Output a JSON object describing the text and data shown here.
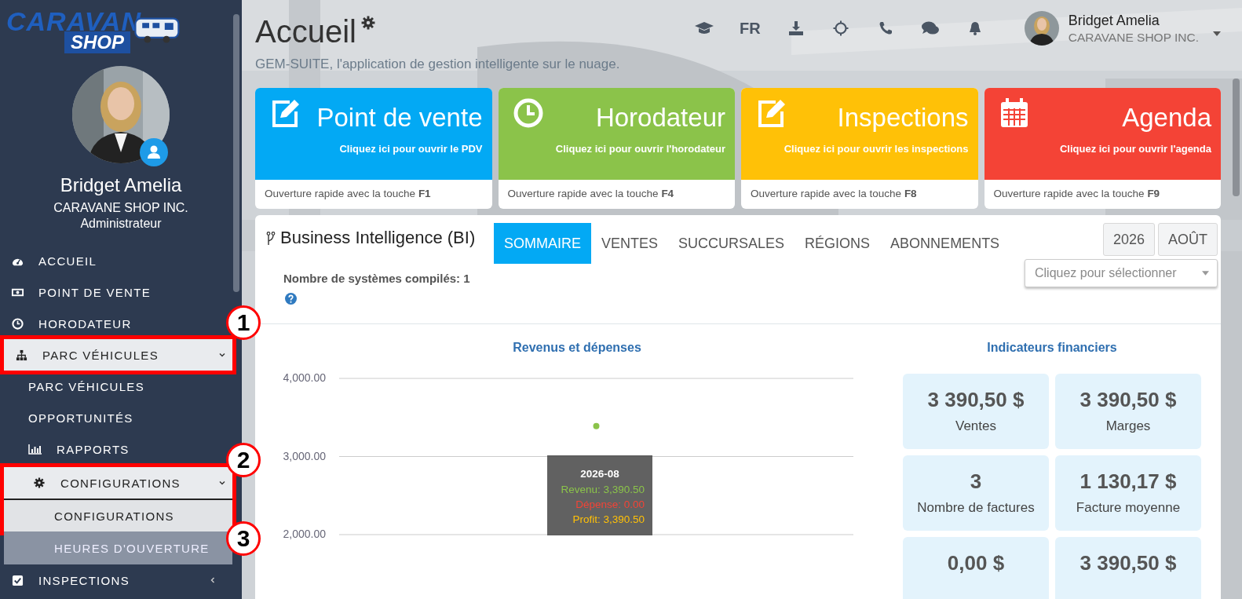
{
  "sidebar": {
    "logo": {
      "line_1": "CARAVAN",
      "line_2": "SHOP"
    },
    "user": {
      "name": "Bridget Amelia",
      "company": "CARAVANE SHOP INC.",
      "role": "Administrateur"
    },
    "menu": [
      {
        "label": "ACCUEIL",
        "selected": false
      },
      {
        "label": "POINT DE VENTE",
        "selected": false
      },
      {
        "label": "HORODATEUR",
        "selected": false
      },
      {
        "label": "PARC VÉHICULES",
        "selected": false,
        "expanded": true,
        "children": [
          {
            "label": "PARC VÉHICULES",
            "selected": false
          },
          {
            "label": "OPPORTUNITÉS",
            "selected": false
          },
          {
            "label": "RAPPORTS",
            "selected": false
          },
          {
            "label": "CONFIGURATIONS",
            "selected": false,
            "expanded": true,
            "children": [
              {
                "label": "CONFIGURATIONS",
                "selected": true,
                "hovered": false
              },
              {
                "label": "HEURES D'OUVERTURE",
                "selected": false,
                "hovered": true
              }
            ]
          }
        ]
      },
      {
        "label": "INSPECTIONS",
        "selected": false,
        "expanded": false
      }
    ]
  },
  "header": {
    "title": "Accueil",
    "subtitle": "GEM-SUITE, l'application de gestion intelligente sur le nuage.",
    "language": "FR",
    "user": {
      "name": "Bridget Amelia",
      "company": "CARAVANE SHOP INC."
    }
  },
  "tiles": [
    {
      "title": "Point de vente",
      "link": "Cliquez ici pour ouvrir le PDV",
      "footer": "Ouverture rapide avec la touche **F1**",
      "color": "#03a9f4"
    },
    {
      "title": "Horodateur",
      "link": "Cliquez ici pour ouvrir l'horodateur",
      "footer": "Ouverture rapide avec la touche **F4**",
      "color": "#8bc34a"
    },
    {
      "title": "Inspections",
      "link": "Cliquez ici pour ouvrir les inspections",
      "footer": "Ouverture rapide avec la touche **F8**",
      "color": "#ffc107"
    },
    {
      "title": "Agenda",
      "link": "Cliquez ici pour ouvrir l'agenda",
      "footer": "Ouverture rapide avec la touche **F9**",
      "color": "#f44336"
    }
  ],
  "bi": {
    "title": "Business Intelligence (BI)",
    "systems": "Nombre de systèmes compilés: 1",
    "tabs": [
      {
        "label": "SOMMAIRE",
        "selected": true
      },
      {
        "label": "VENTES",
        "selected": false
      },
      {
        "label": "SUCCURSALES",
        "selected": false
      },
      {
        "label": "RÉGIONS",
        "selected": false
      },
      {
        "label": "ABONNEMENTS",
        "selected": false
      }
    ],
    "year": "2026",
    "month": "AOÛT",
    "select": {
      "placeholder": "Cliquez pour sélectionner"
    },
    "chart": {
      "chart_data": {
        "type": "line",
        "title": "Revenus et dépenses",
        "categories": [
          "2026-08"
        ],
        "ylim": [
          2000,
          4000
        ],
        "yticks": [
          {
            "value": 2000,
            "label": "2,000.00"
          },
          {
            "value": 3000,
            "label": "3,000.00"
          },
          {
            "value": 4000,
            "label": "4,000.00"
          }
        ],
        "series": [
          {
            "color": "#8bc34a",
            "marker": true,
            "values": [
              3390
            ]
          }
        ]
      },
      "tooltip": {
        "lines": [
          {
            "text": "Revenu: 3,390.50",
            "color": "#8bc34a"
          },
          {
            "text": "Dépense: 0.00",
            "color": "#f44336"
          },
          {
            "text": "Profit: 3,390.50",
            "color": "#ffc107"
          }
        ]
      }
    },
    "indicators": {
      "title": "Indicateurs financiers",
      "cards": [
        {
          "value": "3 390,50 $",
          "label": "Ventes"
        },
        {
          "value": "3 390,50 $",
          "label": "Marges"
        },
        {
          "value": "3",
          "label": "Nombre de factures"
        },
        {
          "value": "1 130,17 $",
          "label": "Facture moyenne"
        },
        {
          "value": "0,00 $"
        },
        {
          "value": "3 390,50 $"
        }
      ]
    }
  },
  "annotations": [
    {
      "label": "1"
    },
    {
      "label": "2"
    },
    {
      "label": "3"
    }
  ]
}
